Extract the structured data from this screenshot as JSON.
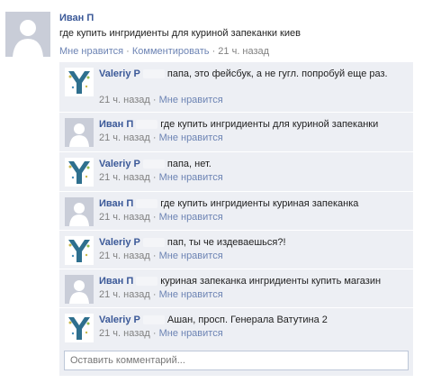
{
  "post": {
    "author": "Иван П",
    "text": "где купить ингридиенты для куриной запеканки киев",
    "like": "Мне нравится",
    "sep1": " · ",
    "comment": "Комментировать",
    "sep2": " · ",
    "time": "21 ч. назад"
  },
  "comments": [
    {
      "author": "Valeriy P",
      "text": "папа, это фейсбук, а не гугл. попробуй еще раз.",
      "time": "21 ч. назад",
      "sep": " · ",
      "like": "Мне нравится",
      "avatar": "tree-logo"
    },
    {
      "author": "Иван П",
      "text": "где купить ингридиенты для куриной запеканки",
      "time": "21 ч. назад",
      "sep": " · ",
      "like": "Мне нравится",
      "avatar": "silhouette"
    },
    {
      "author": "Valeriy P",
      "text": "папа, нет.",
      "time": "21 ч. назад",
      "sep": " · ",
      "like": "Мне нравится",
      "avatar": "tree-logo"
    },
    {
      "author": "Иван П",
      "text": "где купить ингридиенты куриная запеканка",
      "time": "21 ч. назад",
      "sep": " · ",
      "like": "Мне нравится",
      "avatar": "silhouette"
    },
    {
      "author": "Valeriy P",
      "text": "пап, ты че издеваешься?!",
      "time": "21 ч. назад",
      "sep": " · ",
      "like": "Мне нравится",
      "avatar": "tree-logo"
    },
    {
      "author": "Иван П",
      "text": "куриная запеканка ингридиенты купить магазин",
      "time": "21 ч. назад",
      "sep": " · ",
      "like": "Мне нравится",
      "avatar": "silhouette"
    },
    {
      "author": "Valeriy P",
      "text": "Ашан, просп. Генерала Ватутина 2",
      "time": "21 ч. назад",
      "sep": " · ",
      "like": "Мне нравится",
      "avatar": "tree-logo"
    }
  ],
  "reply": {
    "placeholder": "Оставить комментарий..."
  },
  "colors": {
    "link": "#3b5998",
    "meta_link": "#6d84b4",
    "comment_bg": "#edeff4",
    "muted": "#808080"
  }
}
